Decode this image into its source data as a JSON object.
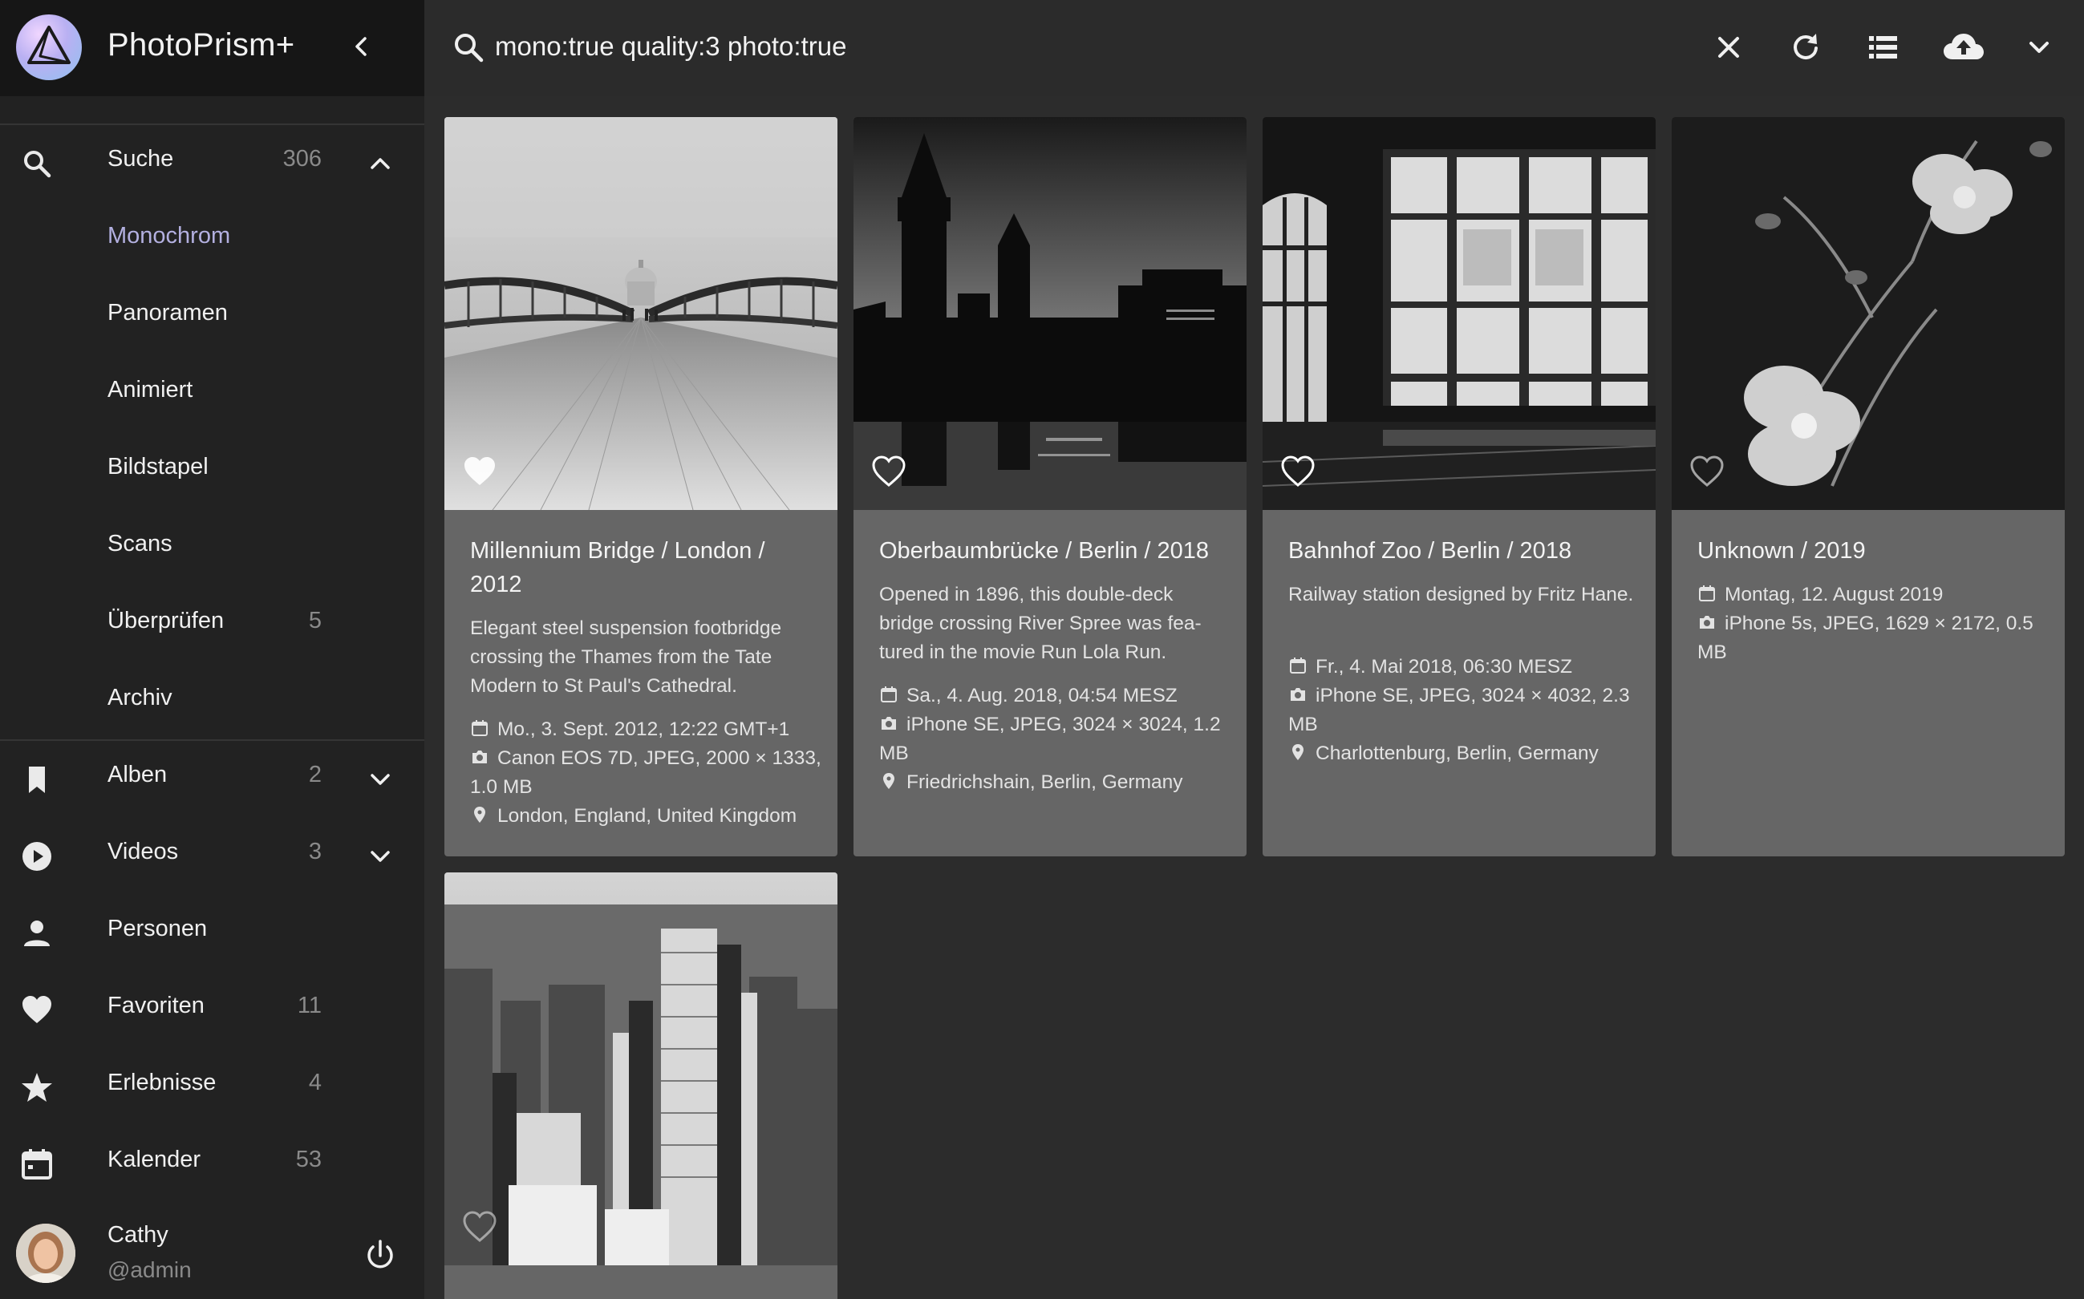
{
  "app": {
    "title": "PhotoPrism+"
  },
  "search": {
    "value": "mono:true quality:3 photo:true"
  },
  "sidebar": {
    "items": [
      {
        "key": "search",
        "label": "Suche",
        "count": "306",
        "icon": "search-icon",
        "expanded": true
      },
      {
        "key": "monochrome",
        "label": "Monochrom",
        "count": "",
        "active": true
      },
      {
        "key": "panoramas",
        "label": "Panoramen",
        "count": ""
      },
      {
        "key": "animated",
        "label": "Animiert",
        "count": ""
      },
      {
        "key": "stacks",
        "label": "Bildstapel",
        "count": ""
      },
      {
        "key": "scans",
        "label": "Scans",
        "count": ""
      },
      {
        "key": "review",
        "label": "Überprüfen",
        "count": "5"
      },
      {
        "key": "archive",
        "label": "Archiv",
        "count": ""
      },
      {
        "key": "albums",
        "label": "Alben",
        "count": "2",
        "icon": "bookmark-icon"
      },
      {
        "key": "videos",
        "label": "Videos",
        "count": "3",
        "icon": "play-circle-icon"
      },
      {
        "key": "people",
        "label": "Personen",
        "count": "",
        "icon": "person-icon"
      },
      {
        "key": "favorites",
        "label": "Favoriten",
        "count": "11",
        "icon": "heart-icon"
      },
      {
        "key": "moments",
        "label": "Erlebnisse",
        "count": "4",
        "icon": "star-icon"
      },
      {
        "key": "calendar",
        "label": "Kalender",
        "count": "53",
        "icon": "calendar-icon"
      }
    ],
    "user": {
      "name": "Cathy",
      "handle": "@admin"
    }
  },
  "cards": [
    {
      "title": "Millennium Bridge / London / 2012",
      "description": "Elegant steel suspension footbridge crossing the Thames from the Tate Modern to St Paul's Cathedral.",
      "date": "Mo., 3. Sept. 2012, 12:22 GMT+1",
      "camera": "Canon EOS 7D, JPEG, 2000 × 1333, 1.0 MB",
      "location": "London, England, United Kingdom"
    },
    {
      "title": "Oberbaumbrücke / Berlin / 2018",
      "description": "Opened in 1896, this double-deck bridge crossing River Spree was fea-tured in the movie Run Lola Run.",
      "date": "Sa., 4. Aug. 2018, 04:54 MESZ",
      "camera": "iPhone SE, JPEG, 3024 × 3024, 1.2 MB",
      "location": "Friedrichshain, Berlin, Germany"
    },
    {
      "title": "Bahnhof Zoo / Berlin / 2018",
      "description": "Railway station designed by Fritz Hane.",
      "date": "Fr., 4. Mai 2018, 06:30 MESZ",
      "camera": "iPhone SE, JPEG, 3024 × 4032, 2.3 MB",
      "location": "Charlottenburg, Berlin, Germany"
    },
    {
      "title": "Unknown / 2019",
      "description": "",
      "date": "Montag, 12. August 2019",
      "camera": "iPhone 5s, JPEG, 1629 × 2172, 0.5 MB",
      "location": ""
    }
  ],
  "colors": {
    "accent": "#b7b3e8",
    "sidebar": "#222222",
    "card": "#666666",
    "background": "#2c2c2c"
  }
}
